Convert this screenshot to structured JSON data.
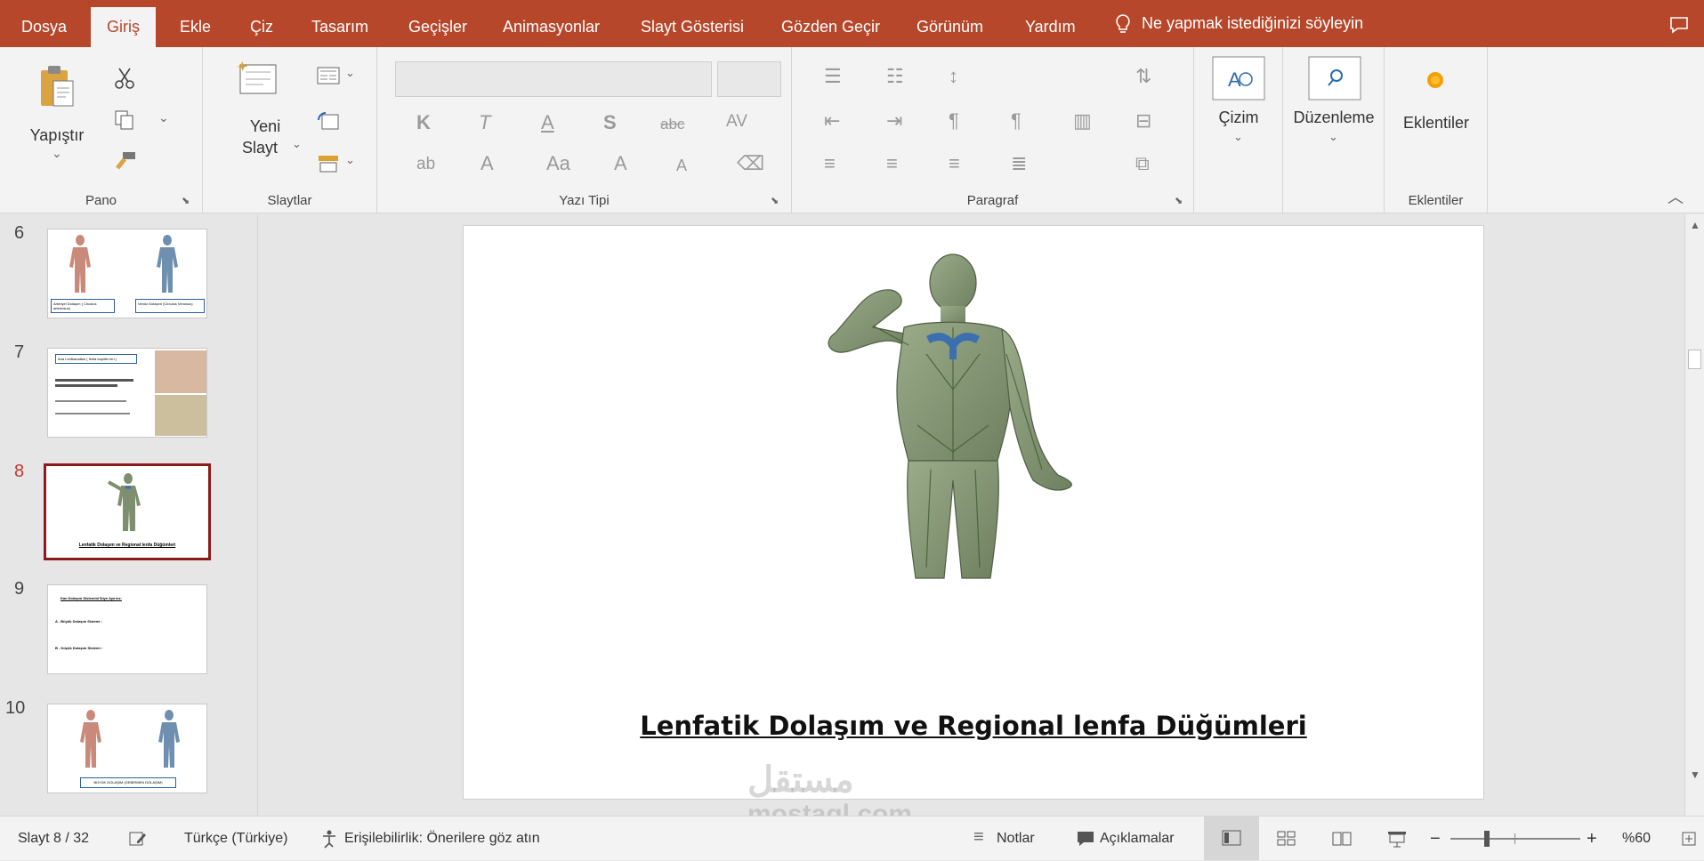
{
  "tabs": [
    "Dosya",
    "Giriş",
    "Ekle",
    "Çiz",
    "Tasarım",
    "Geçişler",
    "Animasyonlar",
    "Slayt Gösterisi",
    "Gözden Geçir",
    "Görünüm",
    "Yardım"
  ],
  "active_tab": "Giriş",
  "tell_me": "Ne yapmak istediğinizi söyleyin",
  "ribbon": {
    "clipboard": {
      "paste_label": "Yapıştır",
      "group_label": "Pano"
    },
    "slides": {
      "new_slide_line1": "Yeni",
      "new_slide_line2": "Slayt",
      "group_label": "Slaytlar"
    },
    "font": {
      "group_label": "Yazı Tipi",
      "bold": "K",
      "italic": "T",
      "underline": "A",
      "shadow": "S",
      "strike": "abc",
      "spacing": "AV",
      "case": "Aa",
      "grow": "A",
      "shrink": "A",
      "color": "A"
    },
    "paragraph": {
      "group_label": "Paragraf"
    },
    "drawing": {
      "label": "Çizim"
    },
    "editing": {
      "label": "Düzenleme"
    },
    "addins": {
      "label": "Eklentiler",
      "group_label": "Eklentiler"
    }
  },
  "slides_panel": {
    "items": [
      {
        "num": "6",
        "caption_left": "Arteriyel Dolaşım ( Circulus arteriosus)",
        "caption_right": "Venöz Dolaşım (Circulus Venosus)"
      },
      {
        "num": "7",
        "title": "Ana Lenfkanalları ( lenfa kapiller leri )"
      },
      {
        "num": "8",
        "caption": "Lenfatik Dolaşım ve Regional lenfa Düğümleri"
      },
      {
        "num": "9",
        "heading": "Kan Dolaşım Sistemini İkiye Ayırırız:",
        "line1": "A - Büyük Dolaşım Sistemi :",
        "line2": "B - Küçük Dolaşım Sistemi :"
      },
      {
        "num": "10",
        "caption": "BÜYÜK DOLAŞIM (GEBİRMEN DOLAŞIM)"
      }
    ],
    "selected": "8"
  },
  "slide": {
    "title": "Lenfatik Dolaşım ve Regional lenfa Düğümleri"
  },
  "status": {
    "slide_count": "Slayt 8 / 32",
    "language": "Türkçe (Türkiye)",
    "accessibility": "Erişilebilirlik: Önerilere göz atın",
    "notes": "Notlar",
    "comments": "Açıklamalar",
    "zoom": "%60",
    "zoom_minus": "−",
    "zoom_plus": "+"
  },
  "watermark": {
    "arabic": "مستقل",
    "latin": "mostaql.com"
  },
  "colors": {
    "accent": "#b7472a",
    "selected_thumb": "#8b1a1a",
    "body_green": "#7d8f6e",
    "vessel_blue": "#3b6fb0"
  }
}
